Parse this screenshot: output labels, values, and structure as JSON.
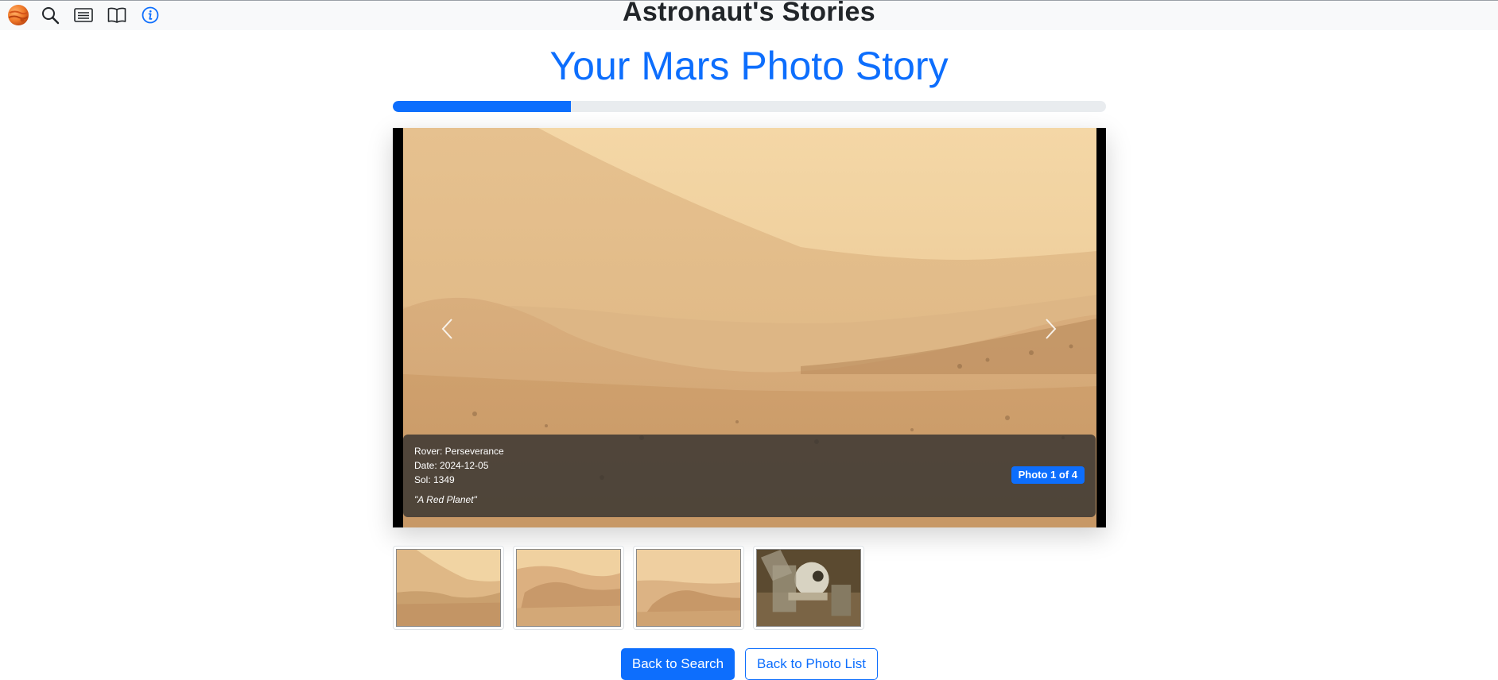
{
  "header": {
    "site_title": "Astronaut's Stories",
    "nav": [
      {
        "icon": "mars-logo-icon"
      },
      {
        "icon": "search-icon"
      },
      {
        "icon": "list-icon"
      },
      {
        "icon": "book-icon"
      },
      {
        "icon": "info-icon"
      }
    ]
  },
  "main": {
    "title": "Your Mars Photo Story",
    "progress_percent": 25,
    "carousel": {
      "rover": "Rover: Perseverance",
      "date": "Date: 2024-12-05",
      "sol": "Sol: 1349",
      "quote": "\"A Red Planet\"",
      "badge": "Photo 1 of 4",
      "prev_icon": "chevron-left-icon",
      "next_icon": "chevron-right-icon"
    },
    "thumbnails": [
      {
        "name": "thumbnail-1"
      },
      {
        "name": "thumbnail-2"
      },
      {
        "name": "thumbnail-3"
      },
      {
        "name": "thumbnail-4"
      }
    ],
    "buttons": {
      "back_to_search": "Back to Search",
      "back_to_photo_list": "Back to Photo List"
    }
  },
  "colors": {
    "accent": "#0d6efd",
    "track": "#e9ecef",
    "text": "#212529"
  }
}
